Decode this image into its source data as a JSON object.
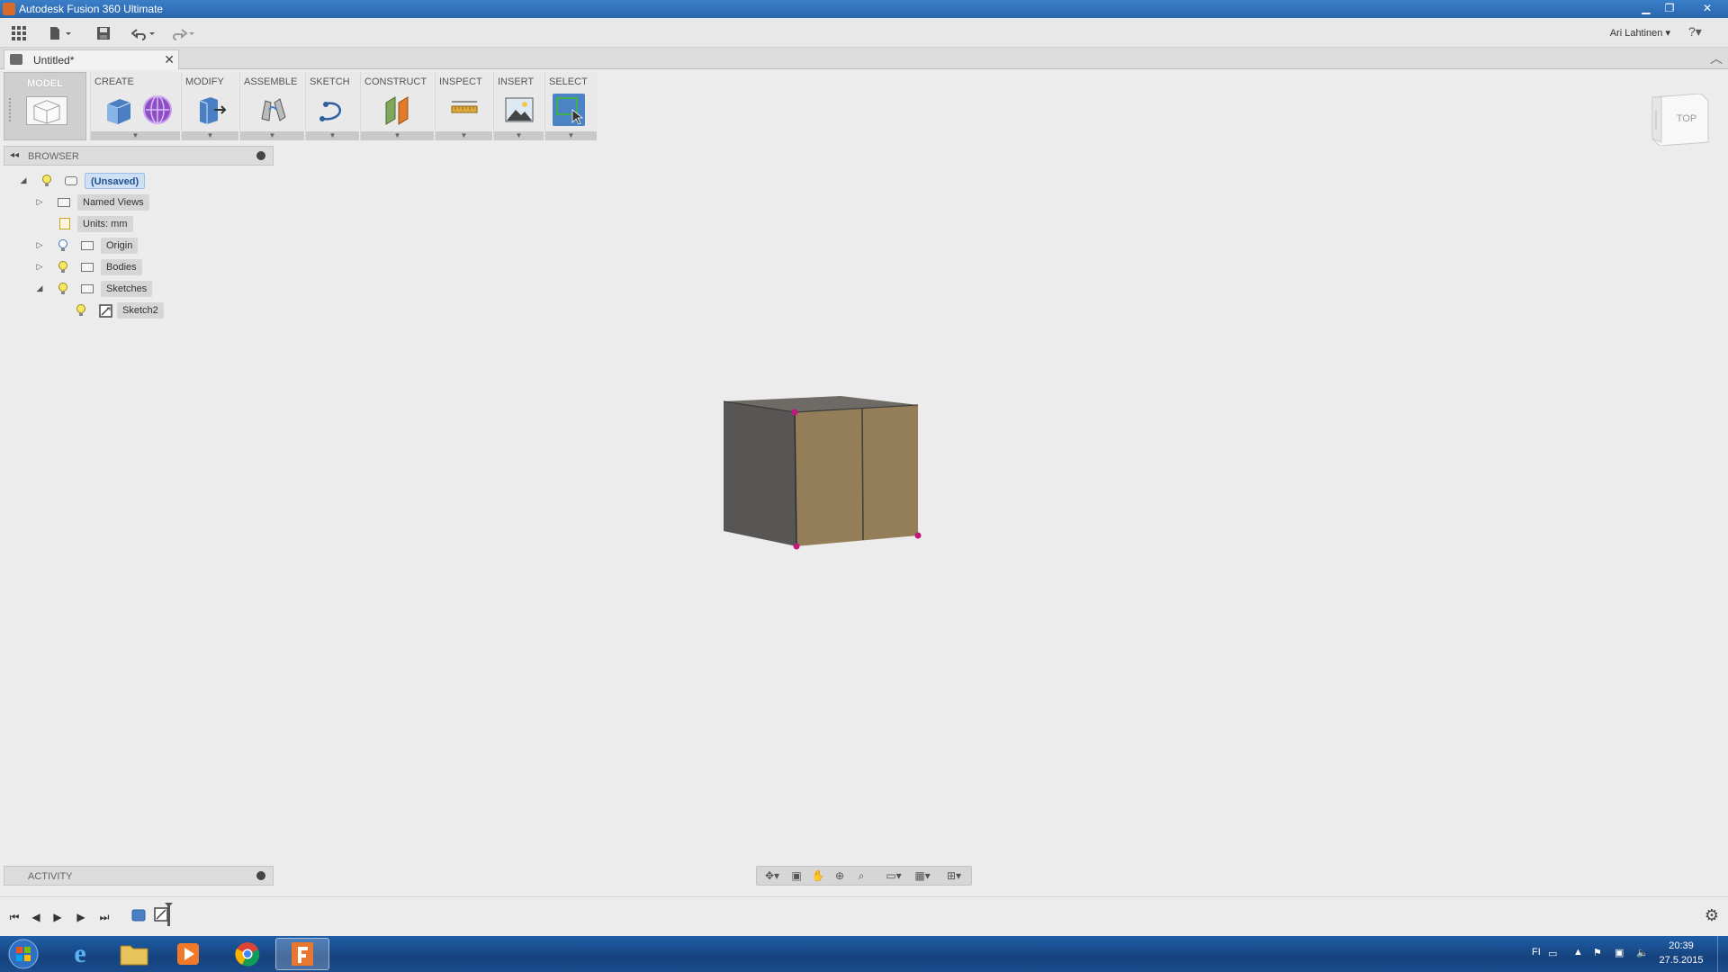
{
  "window": {
    "title": "Autodesk Fusion 360 Ultimate"
  },
  "qat": {
    "user": "Ari Lahtinen ▾",
    "help": "?▾"
  },
  "document": {
    "tab_title": "Untitled*"
  },
  "ribbon": {
    "workspace": "MODEL",
    "panels": [
      "CREATE",
      "MODIFY",
      "ASSEMBLE",
      "SKETCH",
      "CONSTRUCT",
      "INSPECT",
      "INSERT",
      "SELECT"
    ]
  },
  "browser": {
    "title": "BROWSER",
    "tree": [
      {
        "label": "(Unsaved)"
      },
      {
        "label": "Named Views"
      },
      {
        "label": "Units: mm"
      },
      {
        "label": "Origin"
      },
      {
        "label": "Bodies"
      },
      {
        "label": "Sketches"
      },
      {
        "label": "Sketch2"
      }
    ]
  },
  "activity": {
    "title": "ACTIVITY"
  },
  "viewcube": {
    "face_label": "TOP"
  },
  "taskbar": {
    "lang": "FI",
    "time": "20:39",
    "date": "27.5.2015"
  },
  "colors": {
    "titlebar": "#2a66ad",
    "cube_front": "#947e59",
    "cube_side": "#585654",
    "cube_top": "#6e6a66",
    "vertex": "#c2187b",
    "taskbar": "#16427d"
  }
}
